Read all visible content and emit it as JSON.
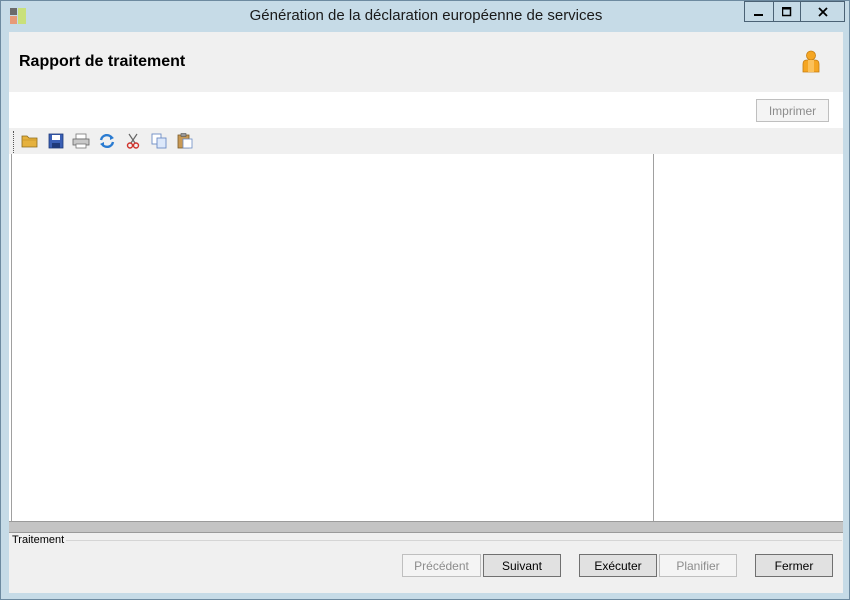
{
  "window": {
    "title": "Génération de la déclaration européenne de services"
  },
  "header": {
    "title": "Rapport de traitement"
  },
  "actions": {
    "print_label": "Imprimer"
  },
  "toolbar": {
    "icons": [
      "folder-open-icon",
      "save-icon",
      "print-icon",
      "refresh-icon",
      "cut-icon",
      "copy-icon",
      "paste-icon"
    ]
  },
  "footer": {
    "group_label": "Traitement",
    "buttons": {
      "previous": "Précédent",
      "next": "Suivant",
      "execute": "Exécuter",
      "schedule": "Planifier",
      "close": "Fermer"
    }
  },
  "colors": {
    "titlebar": "#c6dbe7",
    "panel": "#f0f0f0",
    "accent_user": "#f5a623"
  }
}
